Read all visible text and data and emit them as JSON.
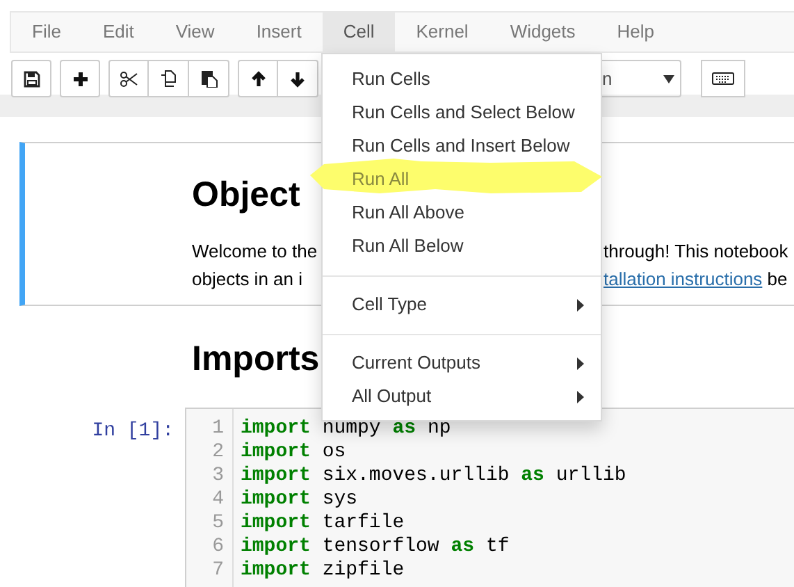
{
  "menubar": [
    {
      "label": "File",
      "selected": false
    },
    {
      "label": "Edit",
      "selected": false
    },
    {
      "label": "View",
      "selected": false
    },
    {
      "label": "Insert",
      "selected": false
    },
    {
      "label": "Cell",
      "selected": true
    },
    {
      "label": "Kernel",
      "selected": false
    },
    {
      "label": "Widgets",
      "selected": false
    },
    {
      "label": "Help",
      "selected": false
    }
  ],
  "toolbar": {
    "groups": [
      {
        "buttons": [
          {
            "kind": "save"
          }
        ]
      },
      {
        "buttons": [
          {
            "kind": "add"
          }
        ]
      },
      {
        "buttons": [
          {
            "kind": "cut"
          },
          {
            "kind": "copy"
          },
          {
            "kind": "paste"
          }
        ]
      },
      {
        "buttons": [
          {
            "kind": "up"
          },
          {
            "kind": "down"
          }
        ]
      }
    ],
    "cell_type_select": {
      "value": "n"
    }
  },
  "menu": {
    "items": [
      {
        "kind": "item",
        "label": "Run Cells",
        "highlighted": false
      },
      {
        "kind": "item",
        "label": "Run Cells and Select Below",
        "highlighted": false
      },
      {
        "kind": "item",
        "label": "Run Cells and Insert Below",
        "highlighted": false
      },
      {
        "kind": "item",
        "label": "Run All",
        "highlighted": true
      },
      {
        "kind": "item",
        "label": "Run All Above",
        "highlighted": false
      },
      {
        "kind": "item",
        "label": "Run All Below",
        "highlighted": false
      },
      {
        "kind": "divider"
      },
      {
        "kind": "submenu",
        "label": "Cell Type",
        "highlighted": false
      },
      {
        "kind": "divider"
      },
      {
        "kind": "submenu",
        "label": "Current Outputs",
        "highlighted": false
      },
      {
        "kind": "submenu",
        "label": "All Output",
        "highlighted": false
      }
    ]
  },
  "markdown_cell": {
    "heading": "Object",
    "lines": [
      {
        "left": "Welcome to the",
        "right": [
          {
            "text": "through! This notebook",
            "link": false
          }
        ]
      },
      {
        "left": "objects in an i",
        "right": [
          {
            "text": "tallation instructions",
            "link": true
          },
          {
            "text": " be",
            "link": false
          }
        ]
      }
    ]
  },
  "section_heading": "Imports",
  "code_cell": {
    "prompt": "In [1]:",
    "lines": [
      {
        "number": "1",
        "tokens": [
          {
            "text": "import",
            "kind": "keyword"
          },
          {
            "text": " numpy ",
            "kind": "plain"
          },
          {
            "text": "as",
            "kind": "keyword"
          },
          {
            "text": " np",
            "kind": "plain"
          }
        ]
      },
      {
        "number": "2",
        "tokens": [
          {
            "text": "import",
            "kind": "keyword"
          },
          {
            "text": " os",
            "kind": "plain"
          }
        ]
      },
      {
        "number": "3",
        "tokens": [
          {
            "text": "import",
            "kind": "keyword"
          },
          {
            "text": " six.moves.urllib ",
            "kind": "plain"
          },
          {
            "text": "as",
            "kind": "keyword"
          },
          {
            "text": " urllib",
            "kind": "plain"
          }
        ]
      },
      {
        "number": "4",
        "tokens": [
          {
            "text": "import",
            "kind": "keyword"
          },
          {
            "text": " sys",
            "kind": "plain"
          }
        ]
      },
      {
        "number": "5",
        "tokens": [
          {
            "text": "import",
            "kind": "keyword"
          },
          {
            "text": " tarfile",
            "kind": "plain"
          }
        ]
      },
      {
        "number": "6",
        "tokens": [
          {
            "text": "import",
            "kind": "keyword"
          },
          {
            "text": " tensorflow ",
            "kind": "plain"
          },
          {
            "text": "as",
            "kind": "keyword"
          },
          {
            "text": " tf",
            "kind": "plain"
          }
        ]
      },
      {
        "number": "7",
        "tokens": [
          {
            "text": "import",
            "kind": "keyword"
          },
          {
            "text": " zipfile",
            "kind": "plain"
          }
        ]
      }
    ]
  }
}
